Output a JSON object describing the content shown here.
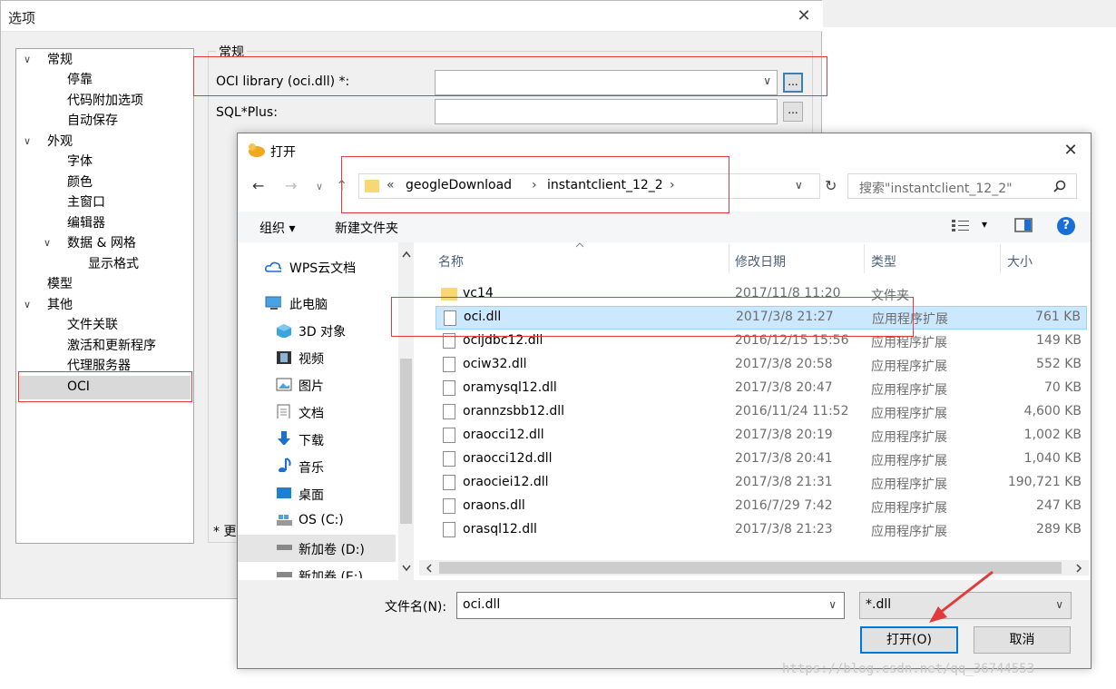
{
  "options_window": {
    "title": "选项",
    "close": "✕",
    "tree": [
      {
        "label": "常规",
        "arrow": "∨"
      },
      {
        "label": "停靠"
      },
      {
        "label": "代码附加选项"
      },
      {
        "label": "自动保存"
      },
      {
        "label": "外观",
        "arrow": "∨"
      },
      {
        "label": "字体"
      },
      {
        "label": "颜色"
      },
      {
        "label": "主窗口"
      },
      {
        "label": "编辑器"
      },
      {
        "label": "数据 & 网格",
        "arrow": "∨"
      },
      {
        "label": "显示格式"
      },
      {
        "label": "模型"
      },
      {
        "label": "其他",
        "arrow": "∨"
      },
      {
        "label": "文件关联"
      },
      {
        "label": "激活和更新程序"
      },
      {
        "label": "代理服务器"
      },
      {
        "label": "OCI"
      }
    ],
    "group_title": "常规",
    "oci_label": "OCI library (oci.dll) *:",
    "sqlplus_label": "SQL*Plus:",
    "browse": "...",
    "dropdown": "∨",
    "footnote": "* 更"
  },
  "open_dialog": {
    "title": "打开",
    "close": "✕",
    "nav": {
      "back": "←",
      "forward": "→",
      "down": "∨",
      "up": "↑"
    },
    "breadcrumb": {
      "prefix": "«",
      "segments": [
        "geogleDownload",
        "instantclient_12_2"
      ],
      "sep": "›",
      "dropdown": "∨",
      "refresh": "↻"
    },
    "search_placeholder": "搜索\"instantclient_12_2\"",
    "toolbar": {
      "organize": "组织 ▾",
      "new_folder": "新建文件夹",
      "view_arrow": "▾",
      "help": "?"
    },
    "nav_pane": [
      "WPS云文档",
      "此电脑",
      "3D 对象",
      "视频",
      "图片",
      "文档",
      "下载",
      "音乐",
      "桌面",
      "OS (C:)",
      "新加卷 (D:)",
      "新加卷 (E:)"
    ],
    "columns": {
      "name": "名称",
      "date": "修改日期",
      "type": "类型",
      "size": "大小"
    },
    "files": [
      {
        "name": "vc14",
        "date": "2017/11/8 11:20",
        "type": "文件夹",
        "size": ""
      },
      {
        "name": "oci.dll",
        "date": "2017/3/8 21:27",
        "type": "应用程序扩展",
        "size": "761 KB"
      },
      {
        "name": "ocijdbc12.dll",
        "date": "2016/12/15 15:56",
        "type": "应用程序扩展",
        "size": "149 KB"
      },
      {
        "name": "ociw32.dll",
        "date": "2017/3/8 20:58",
        "type": "应用程序扩展",
        "size": "552 KB"
      },
      {
        "name": "oramysql12.dll",
        "date": "2017/3/8 20:47",
        "type": "应用程序扩展",
        "size": "70 KB"
      },
      {
        "name": "orannzsbb12.dll",
        "date": "2016/11/24 11:52",
        "type": "应用程序扩展",
        "size": "4,600 KB"
      },
      {
        "name": "oraocci12.dll",
        "date": "2017/3/8 20:19",
        "type": "应用程序扩展",
        "size": "1,002 KB"
      },
      {
        "name": "oraocci12d.dll",
        "date": "2017/3/8 20:41",
        "type": "应用程序扩展",
        "size": "1,040 KB"
      },
      {
        "name": "oraociei12.dll",
        "date": "2017/3/8 21:31",
        "type": "应用程序扩展",
        "size": "190,721 KB"
      },
      {
        "name": "oraons.dll",
        "date": "2016/7/29 7:42",
        "type": "应用程序扩展",
        "size": "247 KB"
      },
      {
        "name": "orasql12.dll",
        "date": "2017/3/8 21:23",
        "type": "应用程序扩展",
        "size": "289 KB"
      }
    ],
    "filename_label": "文件名(N):",
    "filename_value": "oci.dll",
    "filetype_value": "*.dll",
    "open_button": "打开(O)",
    "cancel_button": "取消"
  },
  "watermark": "https://blog.csdn.net/qq_36744553",
  "colors": {
    "annotation_red": "#e23b3b",
    "selection": "#cce8ff",
    "accent": "#0078d7"
  }
}
